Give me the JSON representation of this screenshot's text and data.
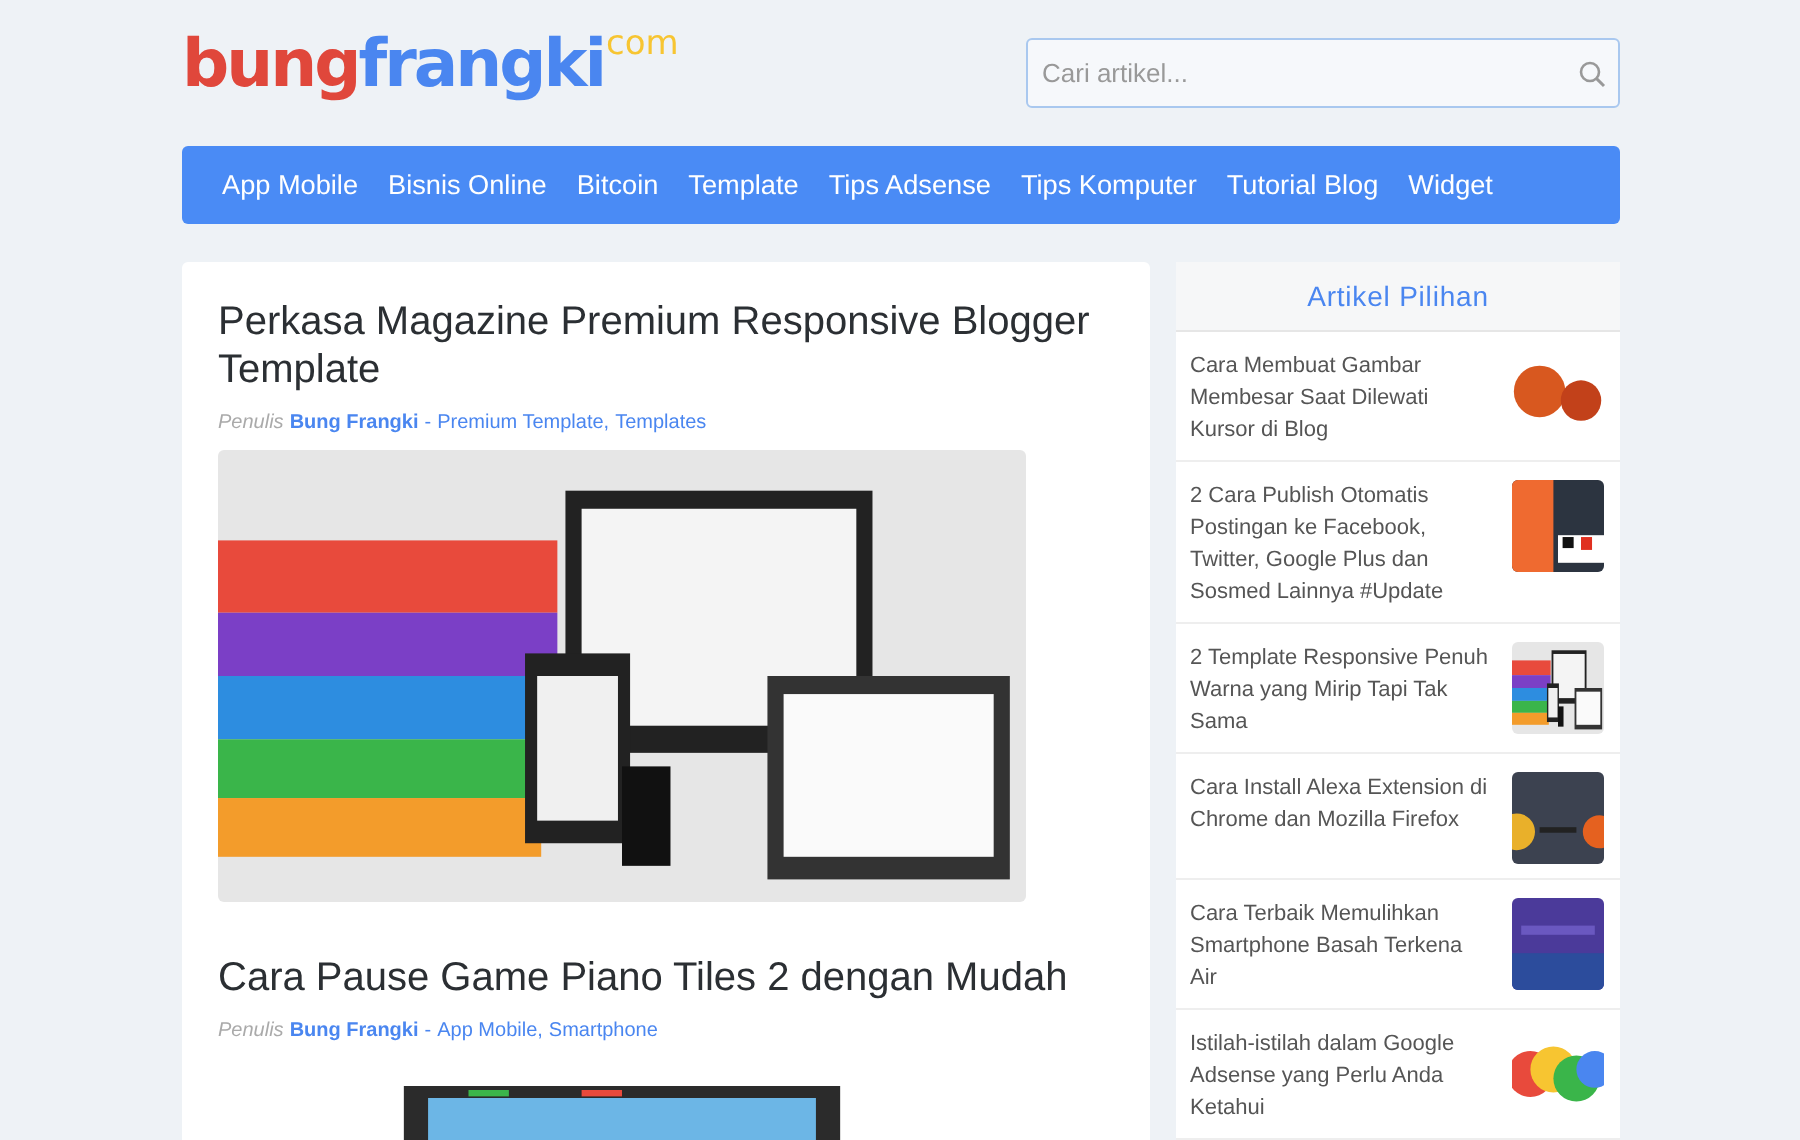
{
  "logo": {
    "parts": [
      {
        "text": "bung",
        "color": "#e0473b",
        "raised": false
      },
      {
        "text": "frangki",
        "color": "#4a86f0",
        "raised": false
      },
      {
        "text": "com",
        "color": "#f7c531",
        "raised": true
      }
    ]
  },
  "search": {
    "placeholder": "Cari artikel..."
  },
  "nav": {
    "items": [
      {
        "label": "App Mobile"
      },
      {
        "label": "Bisnis Online"
      },
      {
        "label": "Bitcoin"
      },
      {
        "label": "Template"
      },
      {
        "label": "Tips Adsense"
      },
      {
        "label": "Tips Komputer"
      },
      {
        "label": "Tutorial Blog"
      },
      {
        "label": "Widget"
      }
    ]
  },
  "posts": [
    {
      "title": "Perkasa Magazine Premium Responsive Blogger Template",
      "meta": {
        "label": "Penulis",
        "author": "Bung Frangki",
        "dash": "-",
        "categories": [
          "Premium Template,",
          "Templates"
        ]
      }
    },
    {
      "title": "Cara Pause Game Piano Tiles 2 dengan Mudah",
      "meta": {
        "label": "Penulis",
        "author": "Bung Frangki",
        "dash": "-",
        "categories": [
          "App Mobile,",
          "Smartphone"
        ]
      }
    }
  ],
  "sidebar": {
    "title": "Artikel Pilihan",
    "items": [
      {
        "title": "Cara Membuat Gambar Membesar Saat Dilewati Kursor di Blog"
      },
      {
        "title": "2 Cara Publish Otomatis Postingan ke Facebook, Twitter, Google Plus dan Sosmed Lainnya #Update"
      },
      {
        "title": "2 Template Responsive Penuh Warna yang Mirip Tapi Tak Sama"
      },
      {
        "title": "Cara Install Alexa Extension di Chrome dan Mozilla Firefox"
      },
      {
        "title": "Cara Terbaik Memulihkan Smartphone Basah Terkena Air"
      },
      {
        "title": "Istilah-istilah dalam Google Adsense yang Perlu Anda Ketahui"
      }
    ]
  }
}
